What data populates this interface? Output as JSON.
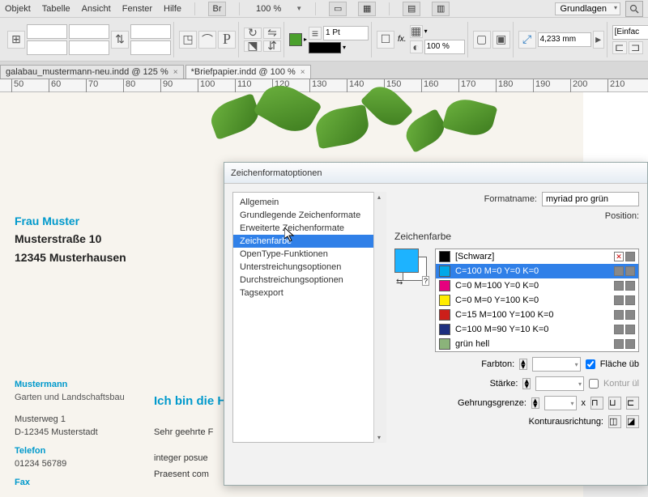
{
  "menubar": {
    "items": [
      "Objekt",
      "Tabelle",
      "Ansicht",
      "Fenster",
      "Hilfe"
    ],
    "br": "Br",
    "zoom": "100 %",
    "workspace": "Grundlagen"
  },
  "toolbar": {
    "stroke_weight": "1 Pt",
    "opacity": "100 %",
    "measure": "4,233 mm",
    "einfach": "[Einfac"
  },
  "doctabs": [
    {
      "label": "galabau_mustermann-neu.indd @ 125 %",
      "active": false
    },
    {
      "label": "*Briefpapier.indd @ 100 %",
      "active": true
    }
  ],
  "ruler_ticks": [
    50,
    60,
    70,
    80,
    90,
    100,
    110,
    120,
    130,
    140,
    150,
    160,
    170,
    180,
    190,
    200,
    210
  ],
  "document": {
    "addressee": {
      "name": "Frau Muster",
      "street": "Musterstraße 10",
      "city": "12345 Musterhausen"
    },
    "footer": {
      "company": "Mustermann",
      "tagline": "Garten und Landschaftsbau",
      "street": "Musterweg 1",
      "city": "D-12345 Musterstadt",
      "phone_label": "Telefon",
      "phone": "01234 56789",
      "fax_label": "Fax"
    },
    "body": {
      "headline": "Ich bin die H",
      "lines": [
        "Sehr geehrte F",
        "integer posue",
        "Praesent com"
      ]
    }
  },
  "dialog": {
    "title": "Zeichenformatoptionen",
    "categories": [
      "Allgemein",
      "Grundlegende Zeichenformate",
      "Erweiterte Zeichenformate",
      "Zeichenfarbe",
      "OpenType-Funktionen",
      "Unterstreichungsoptionen",
      "Durchstreichungsoptionen",
      "Tagsexport"
    ],
    "selected_category_index": 3,
    "formatname_label": "Formatname:",
    "formatname_value": "myriad pro grün",
    "position_label": "Position:",
    "section_heading": "Zeichenfarbe",
    "swatches": [
      {
        "name": "[Schwarz]",
        "color": "#000000",
        "registration": true
      },
      {
        "name": "C=100 M=0 Y=0 K=0",
        "color": "#00a8e8",
        "selected": true
      },
      {
        "name": "C=0 M=100 Y=0 K=0",
        "color": "#e6007e"
      },
      {
        "name": "C=0 M=0 Y=100 K=0",
        "color": "#ffed00"
      },
      {
        "name": "C=15 M=100 Y=100 K=0",
        "color": "#cc1f1a"
      },
      {
        "name": "C=100 M=90 Y=10 K=0",
        "color": "#1d2f7f"
      },
      {
        "name": "grün hell",
        "color": "#8bb37a"
      }
    ],
    "labels": {
      "farbton": "Farbton:",
      "staerke": "Stärke:",
      "gehrung": "Gehrungsgrenze:",
      "kontur_align": "Konturausrichtung:",
      "flaeche_cb": "Fläche üb",
      "kontur_cb": "Kontur ül",
      "x": "x"
    }
  }
}
